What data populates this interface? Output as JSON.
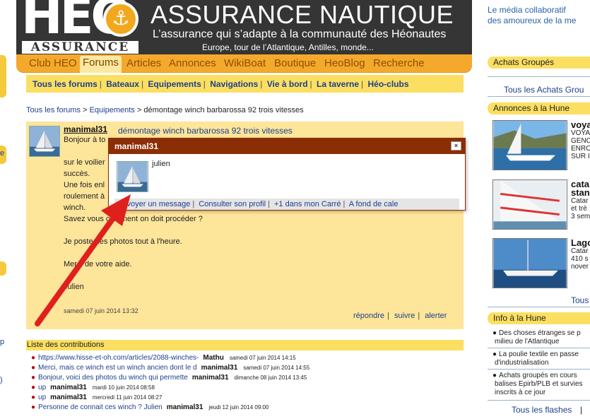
{
  "header": {
    "logo_main": "HEO",
    "logo_anchor": "⚓",
    "logo_sub": "ASSURANCE",
    "title": "ASSURANCE NAUTIQUE",
    "tagline": "L’assurance qui s’adapte à la communauté des Héonautes",
    "subtag": "Europe, tour de l’Atlantique, Antilles, monde..."
  },
  "nav": {
    "items": [
      "Club HEO",
      "Forums",
      "Articles",
      "Annonces",
      "WikiBoat",
      "Boutique",
      "HeoBlog",
      "Recherche"
    ],
    "active": "Forums"
  },
  "subnav": {
    "items": [
      "Tous les forums",
      "Bateaux",
      "Equipements",
      "Navigations",
      "Vie à bord",
      "La taverne",
      "Héo-clubs"
    ]
  },
  "breadcrumb": {
    "parts": [
      "Tous les forums",
      "Equipements",
      "démontage winch barbarossa 92 trois vitesses"
    ],
    "sep": ">"
  },
  "post": {
    "author": "manimal31",
    "title": "démontage winch barbarossa 92 trois vitesses",
    "lines": [
      "Bonjour à to",
      "sur le voilier",
      "succès.",
      "Une fois enl",
      "roulement à",
      "winch.",
      "Savez vous comment on doit procéder ?",
      "Je poste des photos tout à l'heure.",
      "Merci de votre aide.",
      "Julien"
    ],
    "date": "samedi 07 juin 2014 13:32",
    "actions": [
      "répondre",
      "suivre",
      "alerter"
    ]
  },
  "popup": {
    "title": "manimal31",
    "close": "×",
    "name": "julien",
    "actions": [
      "Envoyer un message",
      "Consulter son profil",
      "+1 dans mon Carré",
      "A fond de cale"
    ]
  },
  "contributions": {
    "heading": "Liste des contributions",
    "rows": [
      {
        "text": "https://www.hisse-et-oh.com/articles/2088-winches-",
        "author": "Mathu",
        "date": "samedi 07 juin 2014 14:15"
      },
      {
        "text": "Merci, mais ce winch est un winch ancien dont le d",
        "author": "manimal31",
        "date": "samedi 07 juin 2014 14:55"
      },
      {
        "text": "Bonjour, voici des photos du winch qui permette",
        "author": "manimal31",
        "date": "dimanche 08 juin 2014 13:45"
      },
      {
        "text": "up",
        "author": "manimal31",
        "date": "mardi 10 juin 2014 08:58"
      },
      {
        "text": "up",
        "author": "manimal31",
        "date": "mercredi 11 juin 2014 08:27"
      },
      {
        "text": "Personne de connait ces winch ? Julien",
        "author": "manimal31",
        "date": "jeudi 12 juin 2014 09:00"
      }
    ]
  },
  "sidebar": {
    "tagline1": "Le média collaboratif",
    "tagline2": "des amoureux de la me",
    "achats_head": "Achats Groupés",
    "achats_link": "Tous les Achats Grou",
    "annonces_head": "Annonces à la Hune",
    "annonces": [
      {
        "title": "voya",
        "desc": [
          "VOYA",
          "GENC",
          "ENRO",
          "SUR I"
        ]
      },
      {
        "title": "cata",
        "title2": "stan",
        "desc": [
          "Catar",
          "et trè",
          "3 sem"
        ]
      },
      {
        "title": "Lago",
        "desc": [
          "Catar",
          "410 s",
          "nover"
        ]
      }
    ],
    "tous_link": "Tous",
    "info_head": "Info à la Hune",
    "flashes": [
      [
        "Des choses étranges se p",
        "milieu de l'Atlantique"
      ],
      [
        "La poulie textile en passe",
        "d'industrialisation"
      ],
      [
        "Achats groupés en cours",
        "balises Epirb/PLB et survies",
        "inscrits à ce jour"
      ]
    ],
    "flashes_link": "Tous les flashes",
    "flashes_sep": "|"
  },
  "leftstrip": {
    "frag1": "e",
    "frag2": "p",
    "frag3": ")"
  },
  "colors": {
    "header_bg": "#353535",
    "nav_orange": "#f5a92c",
    "yellow": "#fbdf62",
    "post_bg": "#fde59a",
    "popup_head": "#8b2e05",
    "link": "#1d3f8c",
    "arrow": "#e0201c"
  }
}
